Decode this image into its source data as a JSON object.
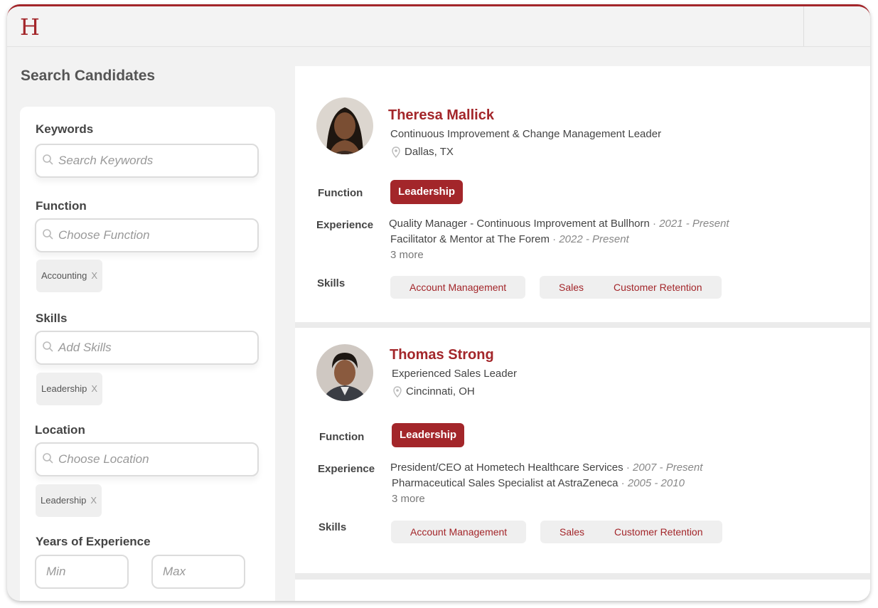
{
  "app": {
    "logo_text": "H"
  },
  "sidebar": {
    "title": "Search Candidates",
    "filters": {
      "keywords": {
        "label": "Keywords",
        "placeholder": "Search Keywords"
      },
      "function": {
        "label": "Function",
        "placeholder": "Choose Function",
        "chips": [
          {
            "label": "Accounting",
            "remove": "X"
          }
        ]
      },
      "skills": {
        "label": "Skills",
        "placeholder": "Add Skills",
        "chips": [
          {
            "label": "Leadership",
            "remove": "X"
          }
        ]
      },
      "location": {
        "label": "Location",
        "placeholder": "Choose Location",
        "chips": [
          {
            "label": "Leadership",
            "remove": "X"
          }
        ]
      },
      "experience": {
        "label": "Years of Experience",
        "min_placeholder": "Min",
        "max_placeholder": "Max"
      }
    }
  },
  "results": {
    "labels": {
      "function": "Function",
      "experience": "Experience",
      "skills": "Skills"
    },
    "candidates": [
      {
        "name": "Theresa Mallick",
        "title": "Continuous Improvement & Change Management Leader",
        "location": "Dallas, TX",
        "function": "Leadership",
        "experience": [
          {
            "role": "Quality Manager - Continuous Improvement at Bullhorn",
            "sep": "·",
            "dates": "2021 - Present"
          },
          {
            "role": "Facilitator & Mentor at The Forem",
            "sep": "·",
            "dates": "2022 - Present"
          }
        ],
        "more": "3 more",
        "skills": [
          "Account Management",
          "Sales",
          "Customer Retention"
        ]
      },
      {
        "name": "Thomas Strong",
        "title": "Experienced Sales Leader",
        "location": "Cincinnati, OH",
        "function": "Leadership",
        "experience": [
          {
            "role": "President/CEO at Hometech Healthcare Services",
            "sep": "·",
            "dates": "2007 - Present"
          },
          {
            "role": "Pharmaceutical Sales Specialist at AstraZeneca",
            "sep": "·",
            "dates": "2005 - 2010"
          }
        ],
        "more": "3 more",
        "skills": [
          "Account Management",
          "Sales",
          "Customer Retention"
        ]
      }
    ]
  },
  "colors": {
    "accent": "#a3262a",
    "background": "#f2f2f2",
    "chip": "#efefef"
  }
}
